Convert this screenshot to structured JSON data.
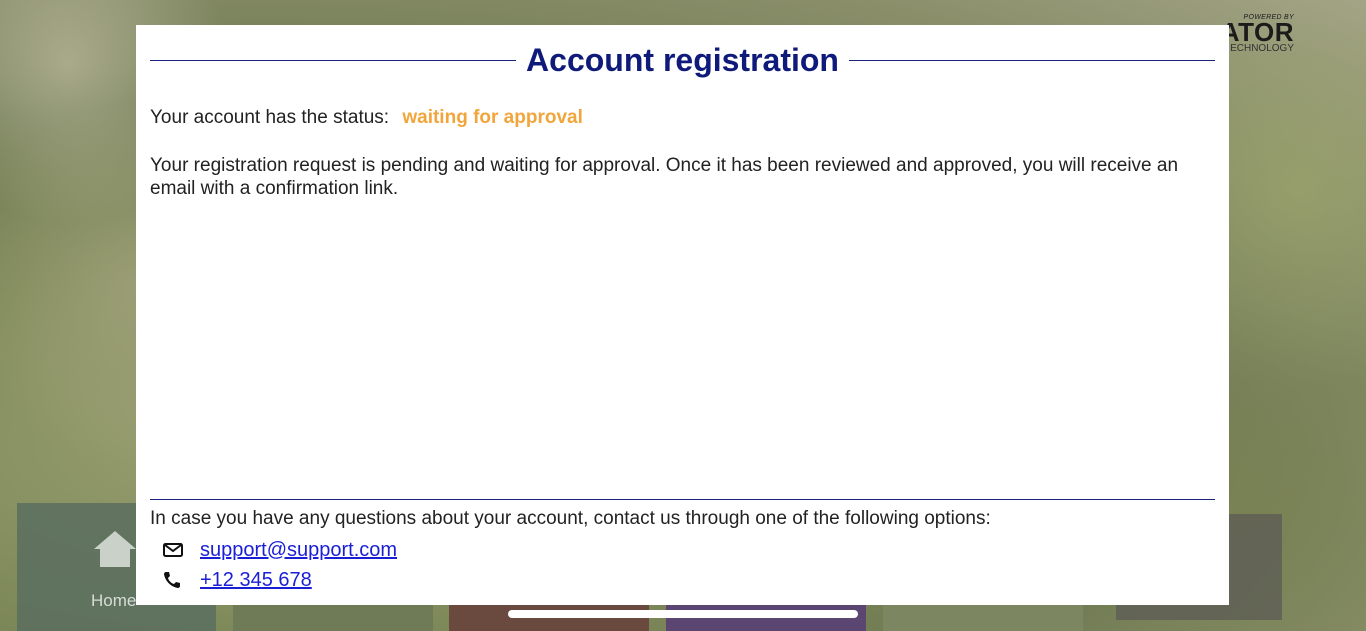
{
  "brand": {
    "powered_by": "POWERED BY",
    "name": "ATOR",
    "subline": "ECHNOLOGY"
  },
  "modal": {
    "title": "Account registration",
    "status_prefix": "Your account has the status:",
    "status_value": "waiting for approval",
    "description": "Your registration request is pending and waiting for approval. Once it has been reviewed and approved, you will receive an email with a confirmation link.",
    "help_text": "In case you have any questions about your account, contact us through one of the following options:",
    "contacts": [
      {
        "icon": "mail-icon",
        "value": "support@support.com"
      },
      {
        "icon": "phone-icon",
        "value": "+12 345 678"
      }
    ]
  },
  "tiles": {
    "home_label": "Home"
  },
  "colors": {
    "accent": "#0f1a7a",
    "status": "#f2a53a",
    "link": "#1a1fd6"
  }
}
